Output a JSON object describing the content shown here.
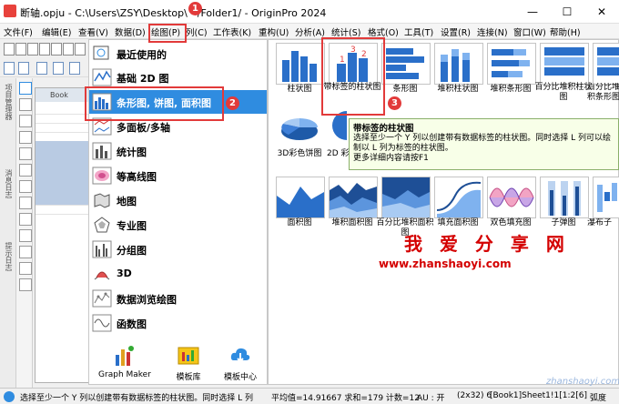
{
  "window": {
    "title": "断轴.opju - C:\\Users\\ZSY\\Desktop\\ - /Folder1/ - OriginPro 2024",
    "minimize": "—",
    "maximize": "☐",
    "close": "✕"
  },
  "menu": [
    "文件(F)",
    "编辑(E)",
    "查看(V)",
    "数据(D)",
    "绘图(P)",
    "列(C)",
    "工作表(K)",
    "重构(U)",
    "分析(A)",
    "统计(S)",
    "格式(O)",
    "工具(T)",
    "设置(R)",
    "连接(N)",
    "窗口(W)",
    "帮助(H)"
  ],
  "workbook_title": "Book",
  "left_tabs": [
    "项目管理器",
    "消息日志",
    "提示日志"
  ],
  "categories": [
    {
      "label": "最近使用的",
      "icon": "recent-icon"
    },
    {
      "label": "基础 2D 图",
      "icon": "line-graph-icon"
    },
    {
      "label": "条形图, 饼图, 面积图",
      "icon": "bar-chart-icon"
    },
    {
      "label": "多面板/多轴",
      "icon": "multi-panel-icon"
    },
    {
      "label": "统计图",
      "icon": "stats-icon"
    },
    {
      "label": "等高线图",
      "icon": "contour-icon"
    },
    {
      "label": "地图",
      "icon": "map-icon"
    },
    {
      "label": "专业图",
      "icon": "special-icon"
    },
    {
      "label": "分组图",
      "icon": "group-icon"
    },
    {
      "label": "3D",
      "icon": "3d-icon"
    },
    {
      "label": "数据浏览绘图",
      "icon": "browse-icon"
    },
    {
      "label": "函数图",
      "icon": "function-icon"
    }
  ],
  "bottom_tools": [
    {
      "label": "Graph Maker",
      "icon": "graph-maker-icon"
    },
    {
      "label": "模板库",
      "icon": "template-library-icon"
    },
    {
      "label": "模板中心",
      "icon": "template-center-icon"
    }
  ],
  "templates_row1": [
    "柱状图",
    "带标签的柱状图",
    "条形图",
    "堆积柱状图",
    "堆积条形图",
    "百分比堆积柱状图",
    "百分比堆积条形图"
  ],
  "templates_row2": [
    "3D彩色饼图",
    "2D 彩"
  ],
  "templates_row3": [
    "面积图",
    "堆积面积图",
    "百分比堆积面积图",
    "填充面积图",
    "双色填充图",
    "子弹图",
    "瀑布子"
  ],
  "thumb_labels": [
    "1",
    "3",
    "2"
  ],
  "tooltip": {
    "title": "带标签的柱状图",
    "body": "选择至少一个 Y 列以创建带有数据标签的柱状图。同时选择 L 列可以绘制以 L 列为标签的柱状图。",
    "more": "更多详细内容请按F1"
  },
  "watermark": {
    "cn": "我 爱 分 享 网",
    "url": "www.zhanshaoyi.com",
    "url_small": "zhanshaoyi.com"
  },
  "status": {
    "hint": "选择至少一个 Y 列以创建带有数据标签的柱状图。同时选择 L 列",
    "stats": "平均值=14.91667 求和=179 计数=12",
    "au": "AU : 开",
    "dims": "(2x32) 6",
    "sheet": "[Book1]Sheet1!1[1:2[6]",
    "unit": "弧度"
  },
  "badges": [
    "1",
    "2",
    "3"
  ],
  "colors": {
    "accent": "#2f8ce0",
    "annotation": "#e23a3a",
    "bar": "#2a6fc9"
  }
}
